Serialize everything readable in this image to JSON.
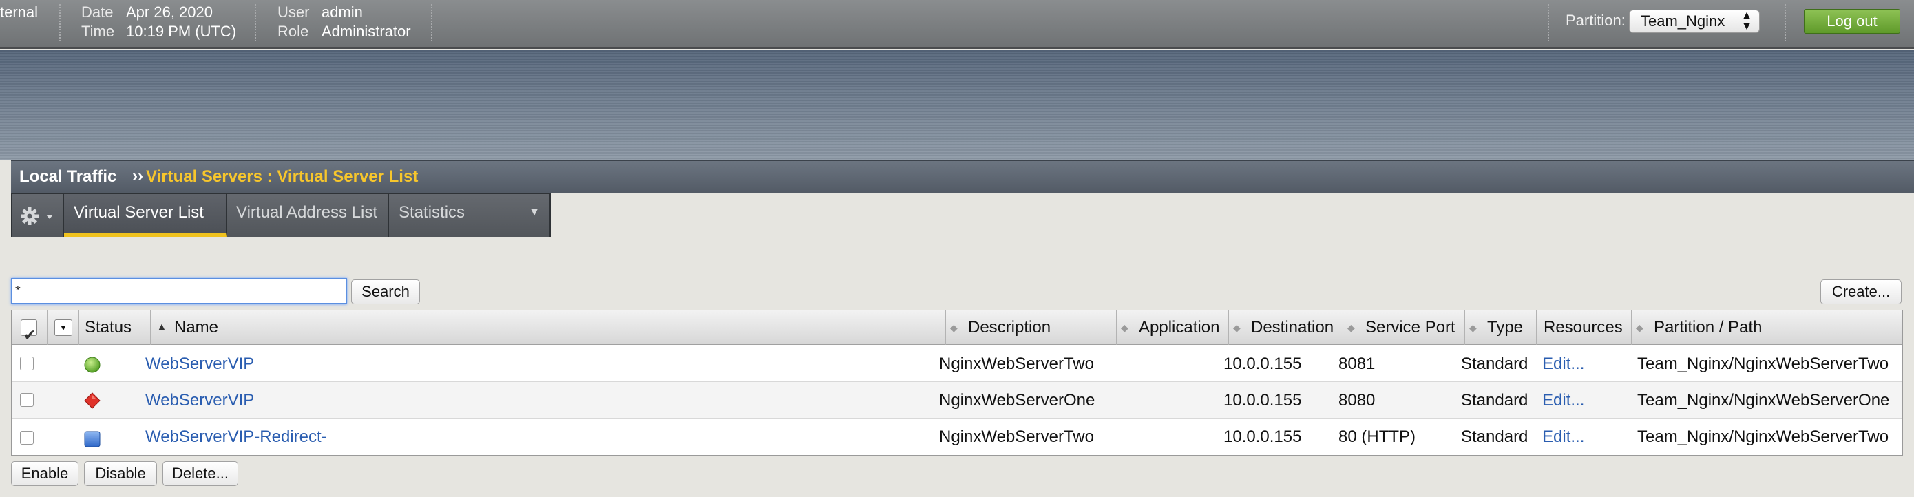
{
  "topbar": {
    "app_fragment": "ternal",
    "date_label": "Date",
    "date_value": "Apr 26, 2020",
    "time_label": "Time",
    "time_value": "10:19 PM (UTC)",
    "user_label": "User",
    "user_value": "admin",
    "role_label": "Role",
    "role_value": "Administrator",
    "partition_label": "Partition:",
    "partition_value": "Team_Nginx",
    "logout_label": "Log out"
  },
  "breadcrumb": {
    "section": "Local Traffic",
    "separator": "››",
    "page": "Virtual Servers : Virtual Server List"
  },
  "tabs": {
    "gear_icon": "gear-icon",
    "items": [
      {
        "label": "Virtual Server List",
        "active": true
      },
      {
        "label": "Virtual Address List",
        "active": false
      },
      {
        "label": "Statistics",
        "active": false,
        "dropdown": true
      }
    ]
  },
  "search": {
    "value": "*",
    "button_label": "Search"
  },
  "create_label": "Create...",
  "table": {
    "headers": [
      "",
      "",
      "Status",
      "Name",
      "Description",
      "Application",
      "Destination",
      "Service Port",
      "Type",
      "Resources",
      "Partition / Path"
    ],
    "rows": [
      {
        "status": "green-circle",
        "name": "WebServerVIP",
        "description": "NginxWebServerTwo",
        "application": "",
        "destination": "10.0.0.155",
        "service_port": "8081",
        "type": "Standard",
        "resources": "Edit...",
        "partition_path": "Team_Nginx/NginxWebServerTwo"
      },
      {
        "status": "red-diamond",
        "name": "WebServerVIP",
        "description": "NginxWebServerOne",
        "application": "",
        "destination": "10.0.0.155",
        "service_port": "8080",
        "type": "Standard",
        "resources": "Edit...",
        "partition_path": "Team_Nginx/NginxWebServerOne"
      },
      {
        "status": "blue-square",
        "name": "WebServerVIP-Redirect-",
        "description": "NginxWebServerTwo",
        "application": "",
        "destination": "10.0.0.155",
        "service_port": "80 (HTTP)",
        "type": "Standard",
        "resources": "Edit...",
        "partition_path": "Team_Nginx/NginxWebServerTwo"
      }
    ]
  },
  "actions": {
    "enable_label": "Enable",
    "disable_label": "Disable",
    "delete_label": "Delete..."
  },
  "colors": {
    "accent_yellow": "#f0c21e",
    "logout_green": "#5f9a2a",
    "link_blue": "#2a5db0"
  }
}
